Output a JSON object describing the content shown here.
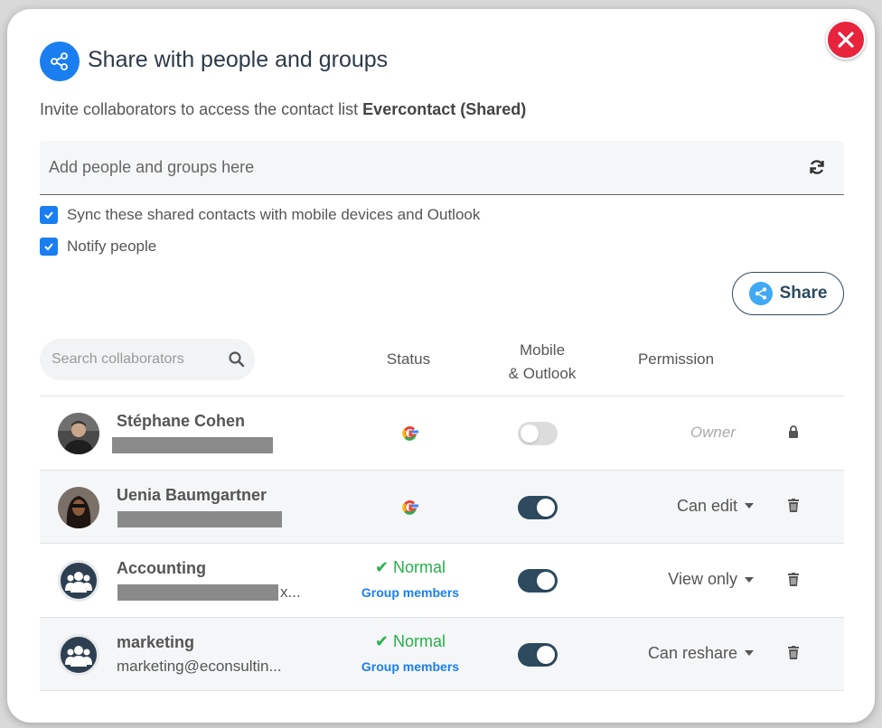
{
  "dialog": {
    "title": "Share with people and groups",
    "subtitle_prefix": "Invite collaborators to access the contact list ",
    "list_name": "Evercontact (Shared)"
  },
  "add_input": {
    "placeholder": "Add people and groups here"
  },
  "options": {
    "sync_label": "Sync these shared contacts with mobile devices and Outlook",
    "notify_label": "Notify people"
  },
  "share_button": {
    "label": "Share"
  },
  "search": {
    "placeholder": "Search collaborators"
  },
  "columns": {
    "status": "Status",
    "mobile_line1": "Mobile",
    "mobile_line2": "& Outlook",
    "permission": "Permission"
  },
  "collaborators": [
    {
      "name": "Stéphane Cohen",
      "email": "",
      "status": "google",
      "mobile_sync": false,
      "permission": "Owner"
    },
    {
      "name": "Uenia Baumgartner",
      "email": "",
      "status": "google",
      "mobile_sync": true,
      "permission": "Can edit"
    },
    {
      "name": "Accounting",
      "email": "x...",
      "status": "Normal",
      "status_sub": "Group members",
      "mobile_sync": true,
      "permission": "View only"
    },
    {
      "name": "marketing",
      "email": "marketing@econsultin...",
      "status": "Normal",
      "status_sub": "Group members",
      "mobile_sync": true,
      "permission": "Can reshare"
    }
  ],
  "colors": {
    "accent": "#1a7ef0",
    "close": "#e8233c",
    "toggle_on": "#2d4a5e",
    "status_ok": "#24b24a"
  }
}
